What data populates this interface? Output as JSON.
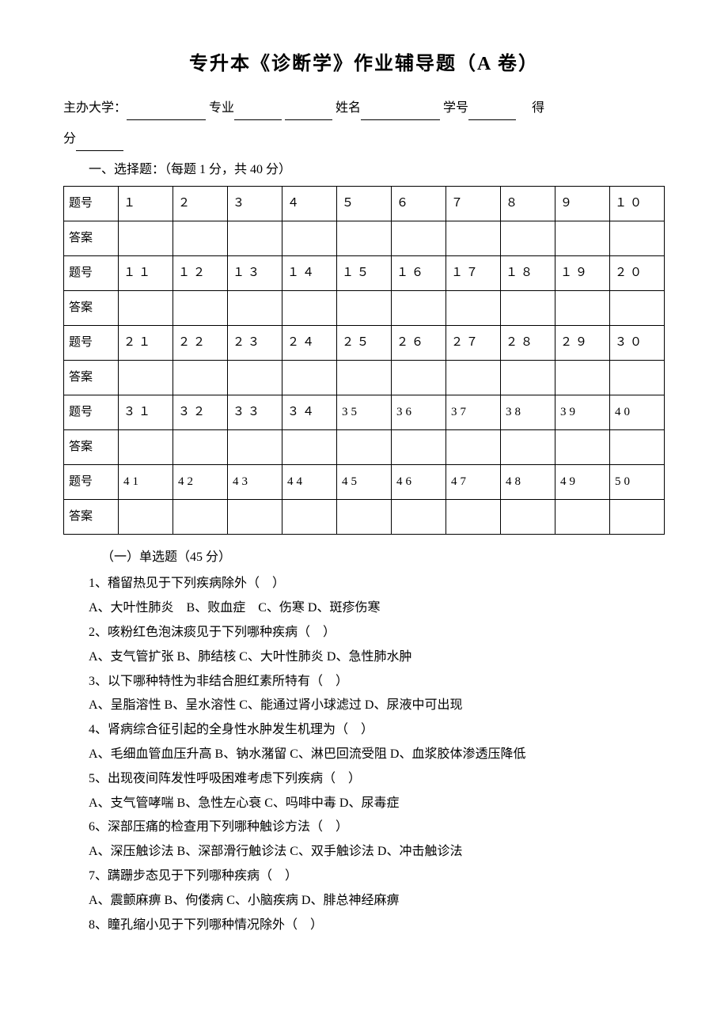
{
  "title": "专升本《诊断学》作业辅导题（A 卷）",
  "info": {
    "university_label": "主办大学：",
    "major_label": "专业",
    "name_label": "姓名",
    "id_label": "学号",
    "score_prefix": "得",
    "score_suffix": "分"
  },
  "section1": {
    "heading": "一、选择题：（每题 1 分，共 40 分）",
    "row_label_q": "题号",
    "row_label_a": "答案",
    "numbers": [
      [
        "１",
        "２",
        "３",
        "４",
        "５",
        "６",
        "７",
        "８",
        "９",
        "１０"
      ],
      [
        "１１",
        "１２",
        "１３",
        "１４",
        "１５",
        "１６",
        "１７",
        "１８",
        "１９",
        "２０"
      ],
      [
        "２１",
        "２２",
        "２３",
        "２４",
        "２５",
        "２６",
        "２７",
        "２８",
        "２９",
        "３０"
      ],
      [
        "３１",
        "３２",
        "３３",
        "３４",
        "35",
        "36",
        "37",
        "38",
        "39",
        "40"
      ],
      [
        "41",
        "42",
        "43",
        "44",
        "45",
        "46",
        "47",
        "48",
        "49",
        "50"
      ]
    ]
  },
  "subsection1": "（一）单选题（45 分）",
  "questions": [
    {
      "q": "1、稽留热见于下列疾病除外（　）",
      "opts": "A、大叶性肺炎　B、败血症　C、伤寒 D、斑疹伤寒"
    },
    {
      "q": "2、咳粉红色泡沫痰见于下列哪种疾病（　）",
      "opts": "A、支气管扩张 B、肺结核 C、大叶性肺炎 D、急性肺水肿"
    },
    {
      "q": "3、以下哪种特性为非结合胆红素所特有（　）",
      "opts": "A、呈脂溶性 B、呈水溶性 C、能通过肾小球滤过 D、尿液中可出现"
    },
    {
      "q": "4、肾病综合征引起的全身性水肿发生机理为（　）",
      "opts": "A、毛细血管血压升高 B、钠水潴留 C、淋巴回流受阻 D、血浆胶体渗透压降低"
    },
    {
      "q": "5、出现夜间阵发性呼吸困难考虑下列疾病（　）",
      "opts": "A、支气管哮喘 B、急性左心衰 C、吗啡中毒 D、尿毒症"
    },
    {
      "q": "6、深部压痛的检查用下列哪种触诊方法（　）",
      "opts": "A、深压触诊法 B、深部滑行触诊法 C、双手触诊法 D、冲击触诊法"
    },
    {
      "q": "7、蹒跚步态见于下列哪种疾病（　）",
      "opts": "A、震颤麻痹 B、佝偻病 C、小脑疾病 D、腓总神经麻痹"
    },
    {
      "q": "8、瞳孔缩小见于下列哪种情况除外（　）",
      "opts": ""
    }
  ]
}
